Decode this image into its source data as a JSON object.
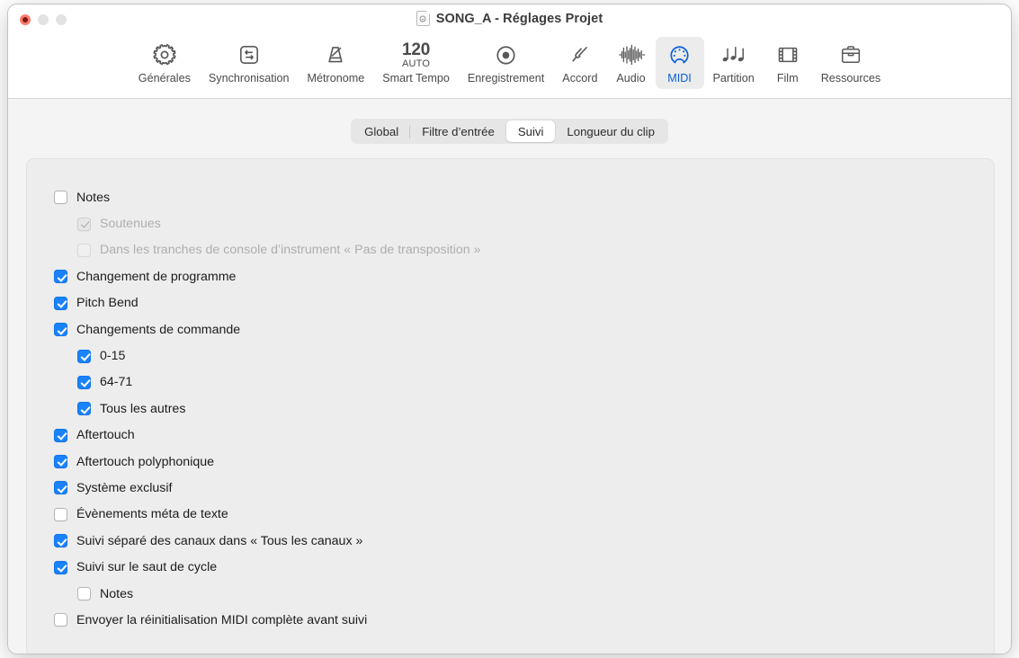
{
  "window": {
    "title": "SONG_A - Réglages Projet",
    "doc_icon": "document-icon",
    "traffic_lights": {
      "close": "close-button",
      "minimize": "minimize-button",
      "zoom": "zoom-button"
    }
  },
  "toolbar": {
    "items": [
      {
        "label": "Générales",
        "icon": "gear-icon",
        "selected": false
      },
      {
        "label": "Synchronisation",
        "icon": "sync-arrows-icon",
        "selected": false
      },
      {
        "label": "Métronome",
        "icon": "metronome-icon",
        "selected": false
      },
      {
        "label": "Smart Tempo",
        "icon": "tempo-icon",
        "selected": false,
        "tempo_value": "120",
        "tempo_mode": "AUTO"
      },
      {
        "label": "Enregistrement",
        "icon": "record-circle-icon",
        "selected": false
      },
      {
        "label": "Accord",
        "icon": "tuning-fork-icon",
        "selected": false
      },
      {
        "label": "Audio",
        "icon": "waveform-icon",
        "selected": false
      },
      {
        "label": "MIDI",
        "icon": "midi-din-icon",
        "selected": true
      },
      {
        "label": "Partition",
        "icon": "music-notes-icon",
        "selected": false
      },
      {
        "label": "Film",
        "icon": "film-strip-icon",
        "selected": false
      },
      {
        "label": "Ressources",
        "icon": "briefcase-icon",
        "selected": false
      }
    ]
  },
  "tabs": [
    {
      "label": "Global",
      "active": false,
      "divider": true
    },
    {
      "label": "Filtre d’entrée",
      "active": false,
      "divider": false
    },
    {
      "label": "Suivi",
      "active": true,
      "divider": false
    },
    {
      "label": "Longueur du clip",
      "active": false,
      "divider": false
    }
  ],
  "options": [
    {
      "label": "Notes",
      "state": "unchecked",
      "indent": 0,
      "disabled": false
    },
    {
      "label": "Soutenues",
      "state": "checked",
      "indent": 1,
      "disabled": true
    },
    {
      "label": "Dans les tranches de console d’instrument « Pas de transposition »",
      "state": "unchecked",
      "indent": 1,
      "disabled": true
    },
    {
      "label": "Changement de programme",
      "state": "checked",
      "indent": 0,
      "disabled": false
    },
    {
      "label": "Pitch Bend",
      "state": "checked",
      "indent": 0,
      "disabled": false
    },
    {
      "label": "Changements de commande",
      "state": "checked",
      "indent": 0,
      "disabled": false
    },
    {
      "label": "0-15",
      "state": "checked",
      "indent": 1,
      "disabled": false
    },
    {
      "label": "64-71",
      "state": "checked",
      "indent": 1,
      "disabled": false
    },
    {
      "label": "Tous les autres",
      "state": "checked",
      "indent": 1,
      "disabled": false
    },
    {
      "label": "Aftertouch",
      "state": "checked",
      "indent": 0,
      "disabled": false
    },
    {
      "label": "Aftertouch polyphonique",
      "state": "checked",
      "indent": 0,
      "disabled": false
    },
    {
      "label": "Système exclusif",
      "state": "checked",
      "indent": 0,
      "disabled": false
    },
    {
      "label": "Évènements méta de texte",
      "state": "unchecked",
      "indent": 0,
      "disabled": false
    },
    {
      "label": "Suivi séparé des canaux dans « Tous les canaux »",
      "state": "checked",
      "indent": 0,
      "disabled": false
    },
    {
      "label": "Suivi sur le saut de cycle",
      "state": "checked",
      "indent": 0,
      "disabled": false
    },
    {
      "label": "Notes",
      "state": "unchecked",
      "indent": 1,
      "disabled": false
    },
    {
      "label": "Envoyer la réinitialisation MIDI complète avant suivi",
      "state": "unchecked",
      "indent": 0,
      "disabled": false
    }
  ],
  "colors": {
    "accent": "#1a82fb",
    "selected_tab_text": "#0b60d8",
    "window_bg": "#f4f4f4",
    "card_bg": "#ededed",
    "close_light": "#ff7a70"
  }
}
